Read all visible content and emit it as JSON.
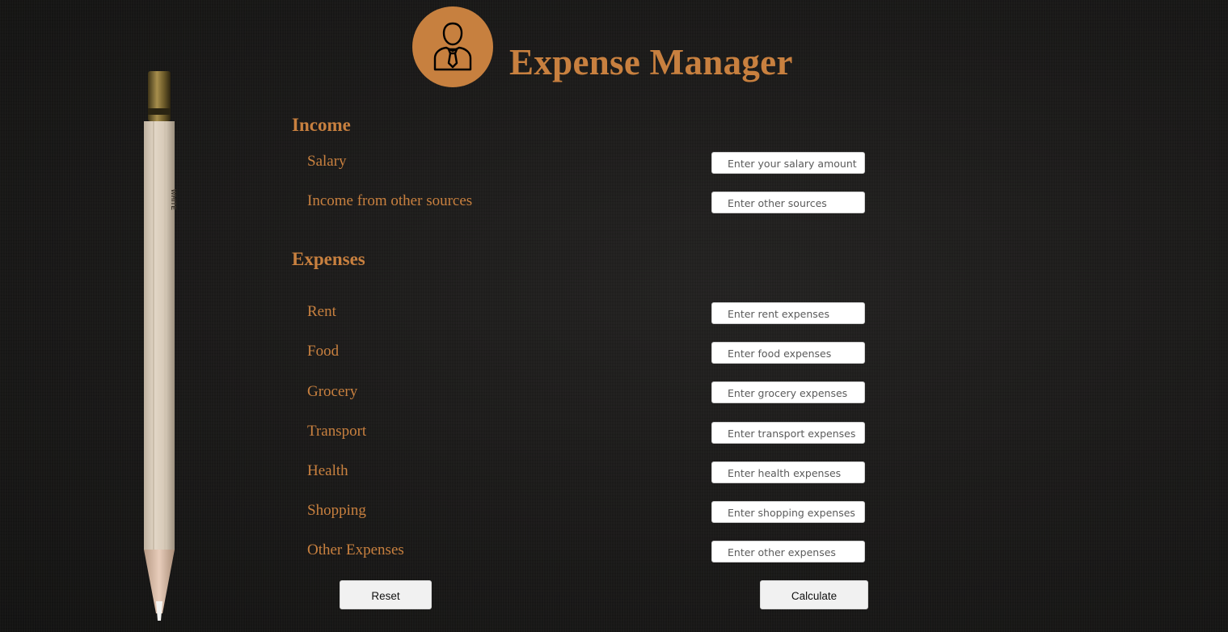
{
  "header": {
    "title": "Expense Manager",
    "logo_icon": "businessman-icon"
  },
  "income": {
    "title": "Income",
    "fields": [
      {
        "label": "Salary",
        "placeholder": "Enter your salary amount",
        "value": ""
      },
      {
        "label": "Income from other sources",
        "placeholder": "Enter other sources",
        "value": ""
      }
    ]
  },
  "expenses": {
    "title": "Expenses",
    "fields": [
      {
        "label": "Rent",
        "placeholder": "Enter rent expenses",
        "value": ""
      },
      {
        "label": "Food",
        "placeholder": "Enter food expenses",
        "value": ""
      },
      {
        "label": "Grocery",
        "placeholder": "Enter grocery expenses",
        "value": ""
      },
      {
        "label": "Transport",
        "placeholder": "Enter transport expenses",
        "value": ""
      },
      {
        "label": "Health",
        "placeholder": "Enter health expenses",
        "value": ""
      },
      {
        "label": "Shopping",
        "placeholder": "Enter shopping expenses",
        "value": ""
      },
      {
        "label": "Other Expenses",
        "placeholder": "Enter other expenses",
        "value": ""
      }
    ]
  },
  "actions": {
    "reset_label": "Reset",
    "calculate_label": "Calculate"
  },
  "colors": {
    "accent": "#c8803f",
    "background": "#1b1a19",
    "button": "#f1f1f1"
  },
  "decoration": {
    "pencil_icon": "pencil-icon",
    "pencil_imprint": "WHITE"
  }
}
